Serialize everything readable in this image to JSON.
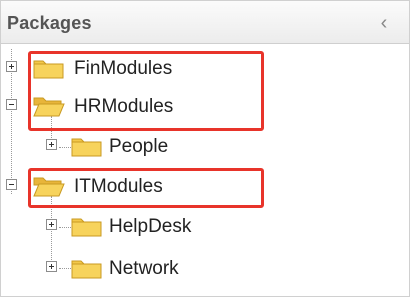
{
  "panel": {
    "title": "Packages",
    "collapse_glyph": "‹"
  },
  "tree": {
    "items": [
      {
        "label": "FinModules",
        "expanded": false,
        "level": 0,
        "icon": "folder-closed-icon"
      },
      {
        "label": "HRModules",
        "expanded": true,
        "level": 0,
        "icon": "folder-open-icon"
      },
      {
        "label": "People",
        "expanded": false,
        "level": 1,
        "icon": "folder-closed-icon"
      },
      {
        "label": "ITModules",
        "expanded": true,
        "level": 0,
        "icon": "folder-open-icon"
      },
      {
        "label": "HelpDesk",
        "expanded": false,
        "level": 1,
        "icon": "folder-closed-icon"
      },
      {
        "label": "Network",
        "expanded": false,
        "level": 1,
        "icon": "folder-closed-icon"
      }
    ]
  },
  "colors": {
    "highlight": "#e8342a",
    "folder_fill": "#f3c84a",
    "folder_edge": "#c99a22"
  }
}
